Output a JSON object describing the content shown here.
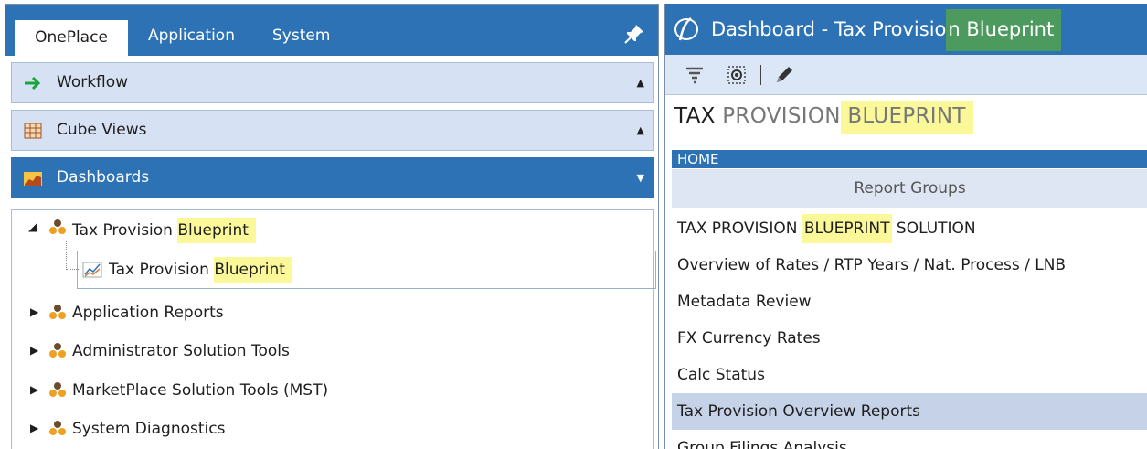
{
  "left_panel": {
    "tabs": [
      {
        "label": "OnePlace",
        "active": true
      },
      {
        "label": "Application",
        "active": false
      },
      {
        "label": "System",
        "active": false
      }
    ],
    "pin_icon": "pin-icon",
    "accordions": {
      "workflow": {
        "label": "Workflow",
        "icon": "arrow-right-icon",
        "caret": "▲"
      },
      "cube_views": {
        "label": "Cube Views",
        "icon": "grid-icon",
        "caret": "▲"
      },
      "dashboards": {
        "label": "Dashboards",
        "icon": "chart-icon",
        "caret": "▼"
      }
    },
    "tree": {
      "root": {
        "label_prefix": "Tax Provision ",
        "label_highlight": "Blueprint",
        "expanded": true
      },
      "child": {
        "label_prefix": "Tax Provision ",
        "label_highlight": "Blueprint"
      },
      "groups": [
        {
          "label": "Application Reports"
        },
        {
          "label": "Administrator Solution Tools"
        },
        {
          "label": "MarketPlace Solution Tools (MST)"
        },
        {
          "label": "System Diagnostics"
        }
      ]
    }
  },
  "right_panel": {
    "title_prefix": "Dashboard - Tax Provisio",
    "title_mid": "n ",
    "title_highlight": "Blueprint",
    "toolbar": [
      "filter-icon",
      "refresh-icon",
      "edit-icon"
    ],
    "big_title": {
      "part1": "TAX",
      "part2": " PROVISION",
      "part3": " BLUEPRINT"
    },
    "home_label": "HOME",
    "report_groups_label": "Report Groups",
    "items": [
      {
        "pre": "TAX PROVISION ",
        "hl": "BLUEPRINT",
        "post": " SOLUTION",
        "selected": false
      },
      {
        "pre": "Overview of Rates / RTP Years / Nat. Process / LNB",
        "hl": "",
        "post": "",
        "selected": false
      },
      {
        "pre": "Metadata Review",
        "hl": "",
        "post": "",
        "selected": false
      },
      {
        "pre": "FX Currency Rates",
        "hl": "",
        "post": "",
        "selected": false
      },
      {
        "pre": "Calc Status",
        "hl": "",
        "post": "",
        "selected": false
      },
      {
        "pre": "Tax Provision Overview Reports",
        "hl": "",
        "post": "",
        "selected": true
      },
      {
        "pre": "Group Filings Analysis",
        "hl": "",
        "post": "",
        "selected": false
      }
    ]
  },
  "colors": {
    "primary_blue": "#2c72b4",
    "accordion_bg": "#d6e2f4",
    "highlight_yellow": "#fbf89a",
    "highlight_green": "#4d9a5e",
    "orange_dots": "#f0a020"
  }
}
